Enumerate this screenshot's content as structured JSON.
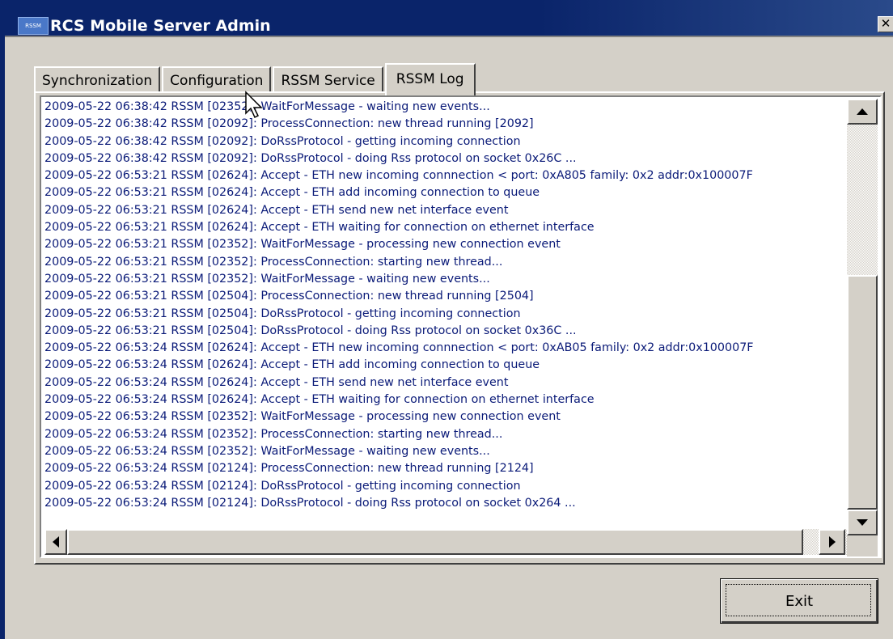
{
  "window": {
    "title": "RCS Mobile Server Admin",
    "app_icon_text": "RSSM",
    "close_glyph": "✕"
  },
  "tabs": [
    {
      "label": "Synchronization",
      "active": false
    },
    {
      "label": "Configuration",
      "active": false
    },
    {
      "label": "RSSM Service",
      "active": false
    },
    {
      "label": "RSSM Log",
      "active": true
    }
  ],
  "log": {
    "lines": [
      "2009-05-22 06:38:42 RSSM [02352]: WaitForMessage - waiting new events...",
      "2009-05-22 06:38:42 RSSM [02092]: ProcessConnection: new thread running [2092]",
      "2009-05-22 06:38:42 RSSM [02092]: DoRssProtocol - getting incoming connection",
      "2009-05-22 06:38:42 RSSM [02092]: DoRssProtocol - doing Rss protocol on socket 0x26C ...",
      "2009-05-22 06:53:21 RSSM [02624]: Accept - ETH new incoming connnection < port: 0xA805 family: 0x2 addr:0x100007F",
      "2009-05-22 06:53:21 RSSM [02624]: Accept - ETH add incoming connection to queue",
      "2009-05-22 06:53:21 RSSM [02624]: Accept - ETH send new net interface event",
      "2009-05-22 06:53:21 RSSM [02624]: Accept - ETH waiting for connection on ethernet interface",
      "2009-05-22 06:53:21 RSSM [02352]: WaitForMessage - processing new connection event",
      "2009-05-22 06:53:21 RSSM [02352]: ProcessConnection: starting new thread...",
      "2009-05-22 06:53:21 RSSM [02352]: WaitForMessage - waiting new events...",
      "2009-05-22 06:53:21 RSSM [02504]: ProcessConnection: new thread running [2504]",
      "2009-05-22 06:53:21 RSSM [02504]: DoRssProtocol - getting incoming connection",
      "2009-05-22 06:53:21 RSSM [02504]: DoRssProtocol - doing Rss protocol on socket 0x36C ...",
      "2009-05-22 06:53:24 RSSM [02624]: Accept - ETH new incoming connnection < port: 0xAB05 family: 0x2 addr:0x100007F",
      "2009-05-22 06:53:24 RSSM [02624]: Accept - ETH add incoming connection to queue",
      "2009-05-22 06:53:24 RSSM [02624]: Accept - ETH send new net interface event",
      "2009-05-22 06:53:24 RSSM [02624]: Accept - ETH waiting for connection on ethernet interface",
      "2009-05-22 06:53:24 RSSM [02352]: WaitForMessage - processing new connection event",
      "2009-05-22 06:53:24 RSSM [02352]: ProcessConnection: starting new thread...",
      "2009-05-22 06:53:24 RSSM [02352]: WaitForMessage - waiting new events...",
      "2009-05-22 06:53:24 RSSM [02124]: ProcessConnection: new thread running [2124]",
      "2009-05-22 06:53:24 RSSM [02124]: DoRssProtocol - getting incoming connection",
      "2009-05-22 06:53:24 RSSM [02124]: DoRssProtocol - doing Rss protocol on socket 0x264 ..."
    ]
  },
  "buttons": {
    "exit_label": "Exit"
  },
  "colors": {
    "log_text": "#0a1a78",
    "titlebar": "#0a246a",
    "dialog_face": "#d4d0c8"
  }
}
